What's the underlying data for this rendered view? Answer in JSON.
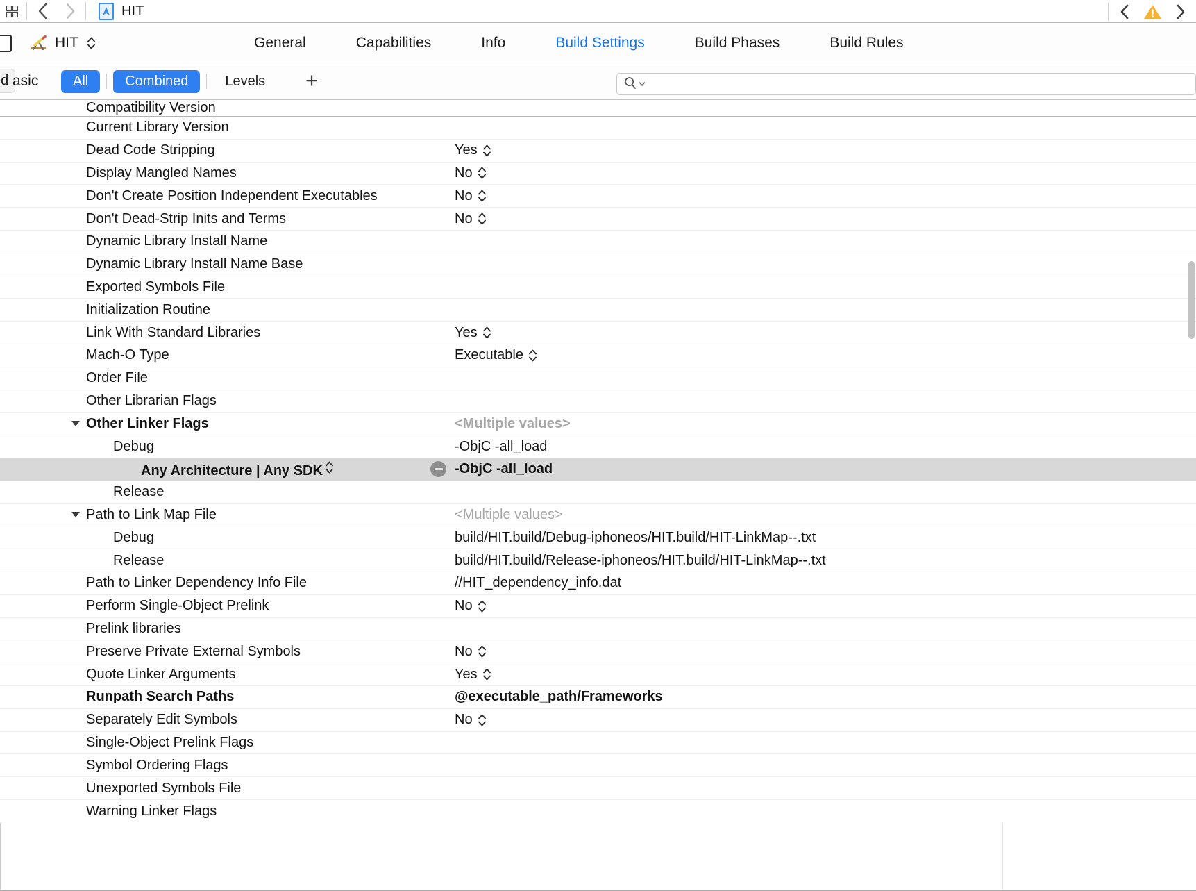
{
  "titlebar": {
    "grid_icon": "panel-toggle-icon",
    "back_label": "‹",
    "forward_label": "›",
    "document_icon": "xcode-project-icon",
    "document_title": "HIT",
    "issue_prev_label": "‹",
    "warning_icon": "warning-triangle-icon",
    "issue_next_label": "›"
  },
  "project_bar": {
    "target_icon": "xcode-target-icon",
    "target_name": "HIT",
    "stepper_icon": "stepper-updown-icon",
    "tabs": [
      {
        "label": "General",
        "active": false
      },
      {
        "label": "Capabilities",
        "active": false
      },
      {
        "label": "Info",
        "active": false
      },
      {
        "label": "Build Settings",
        "active": true
      },
      {
        "label": "Build Phases",
        "active": false
      },
      {
        "label": "Build Rules",
        "active": false
      }
    ]
  },
  "filter_bar": {
    "clipped_pill_label": "ed",
    "clipped_basic_label": "asic",
    "segments": [
      {
        "label": "All",
        "selected": true
      },
      {
        "label": "Combined",
        "selected": true
      },
      {
        "label": "Levels",
        "selected": false
      }
    ],
    "add_button_label": "+",
    "search": {
      "icon": "search-icon",
      "chevron_icon": "chevron-down-icon",
      "value": "",
      "placeholder": ""
    }
  },
  "settings_table": {
    "rows": [
      {
        "name": "Compatibility Version",
        "value": "",
        "indent": 0,
        "bold": false,
        "clipped": true
      },
      {
        "name": "Current Library Version",
        "value": "",
        "indent": 0,
        "bold": false
      },
      {
        "name": "Dead Code Stripping",
        "value": "Yes",
        "indent": 0,
        "bold": false,
        "stepper": true
      },
      {
        "name": "Display Mangled Names",
        "value": "No",
        "indent": 0,
        "bold": false,
        "stepper": true
      },
      {
        "name": "Don't Create Position Independent Executables",
        "value": "No",
        "indent": 0,
        "bold": false,
        "stepper": true
      },
      {
        "name": "Don't Dead-Strip Inits and Terms",
        "value": "No",
        "indent": 0,
        "bold": false,
        "stepper": true
      },
      {
        "name": "Dynamic Library Install Name",
        "value": "",
        "indent": 0,
        "bold": false
      },
      {
        "name": "Dynamic Library Install Name Base",
        "value": "",
        "indent": 0,
        "bold": false
      },
      {
        "name": "Exported Symbols File",
        "value": "",
        "indent": 0,
        "bold": false
      },
      {
        "name": "Initialization Routine",
        "value": "",
        "indent": 0,
        "bold": false
      },
      {
        "name": "Link With Standard Libraries",
        "value": "Yes",
        "indent": 0,
        "bold": false,
        "stepper": true
      },
      {
        "name": "Mach-O Type",
        "value": "Executable",
        "indent": 0,
        "bold": false,
        "stepper": true
      },
      {
        "name": "Order File",
        "value": "",
        "indent": 0,
        "bold": false
      },
      {
        "name": "Other Librarian Flags",
        "value": "",
        "indent": 0,
        "bold": false
      },
      {
        "name": "Other Linker Flags",
        "value": "<Multiple values>",
        "indent": 0,
        "bold": true,
        "expanded": true,
        "muted_value": true
      },
      {
        "name": "Debug",
        "value": "-ObjC -all_load",
        "indent": 1,
        "bold": false
      },
      {
        "name": "Any Architecture | Any SDK",
        "value": "-ObjC -all_load",
        "indent": 2,
        "bold": true,
        "selected": true,
        "stepper": true,
        "remove_button": true
      },
      {
        "name": "Release",
        "value": "",
        "indent": 1,
        "bold": false
      },
      {
        "name": "Path to Link Map File",
        "value": "<Multiple values>",
        "indent": 0,
        "bold": false,
        "expanded": true,
        "muted_value": true
      },
      {
        "name": "Debug",
        "value": "build/HIT.build/Debug-iphoneos/HIT.build/HIT-LinkMap--.txt",
        "indent": 1,
        "bold": false
      },
      {
        "name": "Release",
        "value": "build/HIT.build/Release-iphoneos/HIT.build/HIT-LinkMap--.txt",
        "indent": 1,
        "bold": false
      },
      {
        "name": "Path to Linker Dependency Info File",
        "value": "//HIT_dependency_info.dat",
        "indent": 0,
        "bold": false
      },
      {
        "name": "Perform Single-Object Prelink",
        "value": "No",
        "indent": 0,
        "bold": false,
        "stepper": true
      },
      {
        "name": "Prelink libraries",
        "value": "",
        "indent": 0,
        "bold": false
      },
      {
        "name": "Preserve Private External Symbols",
        "value": "No",
        "indent": 0,
        "bold": false,
        "stepper": true
      },
      {
        "name": "Quote Linker Arguments",
        "value": "Yes",
        "indent": 0,
        "bold": false,
        "stepper": true
      },
      {
        "name": "Runpath Search Paths",
        "value": "@executable_path/Frameworks",
        "indent": 0,
        "bold": true
      },
      {
        "name": "Separately Edit Symbols",
        "value": "No",
        "indent": 0,
        "bold": false,
        "stepper": true
      },
      {
        "name": "Single-Object Prelink Flags",
        "value": "",
        "indent": 0,
        "bold": false
      },
      {
        "name": "Symbol Ordering Flags",
        "value": "",
        "indent": 0,
        "bold": false
      },
      {
        "name": "Unexported Symbols File",
        "value": "",
        "indent": 0,
        "bold": false
      },
      {
        "name": "Warning Linker Flags",
        "value": "",
        "indent": 0,
        "bold": false,
        "clipped_bottom": true
      }
    ]
  },
  "colors": {
    "accent_blue": "#2d7ff2",
    "active_tab_blue": "#1272e4",
    "selection_gray": "#d8d8d8",
    "muted_text": "#a7a7a7",
    "warning_yellow": "#f5b335"
  }
}
